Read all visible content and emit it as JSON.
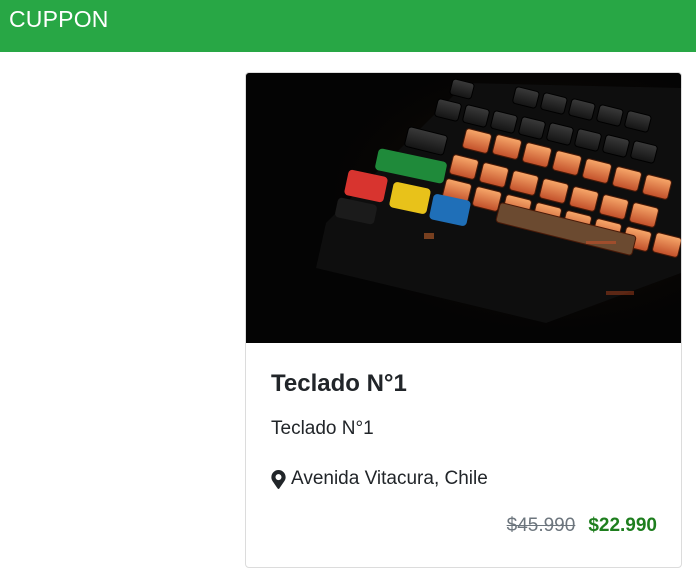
{
  "navbar": {
    "brand": "CUPPON",
    "color": "#28a745"
  },
  "card": {
    "image_subject": "backlit mechanical keyboard",
    "title": "Teclado N°1",
    "description": "Teclado N°1",
    "location_icon": "map-marker-icon",
    "location": "Avenida Vitacura, Chile",
    "old_price": "$45.990",
    "new_price": "$22.990",
    "price_color": "#1e7e1e"
  }
}
